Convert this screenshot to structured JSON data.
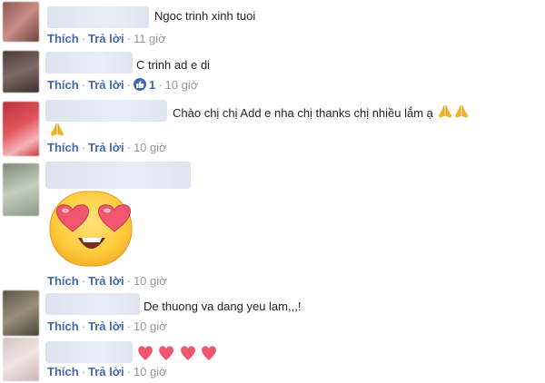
{
  "comments": [
    {
      "text": "Ngoc trinh xinh tuoi",
      "actions": {
        "like": "Thích",
        "reply": "Trả lời",
        "time": "11 giờ"
      }
    },
    {
      "text": "C trinh ad e di",
      "actions": {
        "like": "Thích",
        "reply": "Trả lời",
        "likes": "1",
        "time": "10 giờ"
      }
    },
    {
      "text": "Chào chị chị Add e nha chị thanks chị nhiều lắm ạ",
      "actions": {
        "like": "Thích",
        "reply": "Trả lời",
        "time": "10 giờ"
      }
    },
    {
      "text": "",
      "sticker": "heart-eyes-sticker",
      "actions": {
        "like": "Thích",
        "reply": "Trả lời",
        "time": "10 giờ"
      }
    },
    {
      "text": "De thuong va dang yeu lam,,,!",
      "actions": {
        "like": "Thích",
        "reply": "Trả lời",
        "time": "10 giờ"
      }
    },
    {
      "text": "",
      "emoji": "hearts",
      "actions": {
        "like": "Thích",
        "reply": "Trả lời",
        "time": "10 giờ"
      }
    }
  ],
  "colors": {
    "link": "#4267b2",
    "meta": "#90949c",
    "text": "#1d2129",
    "heart": "#f0566e"
  }
}
